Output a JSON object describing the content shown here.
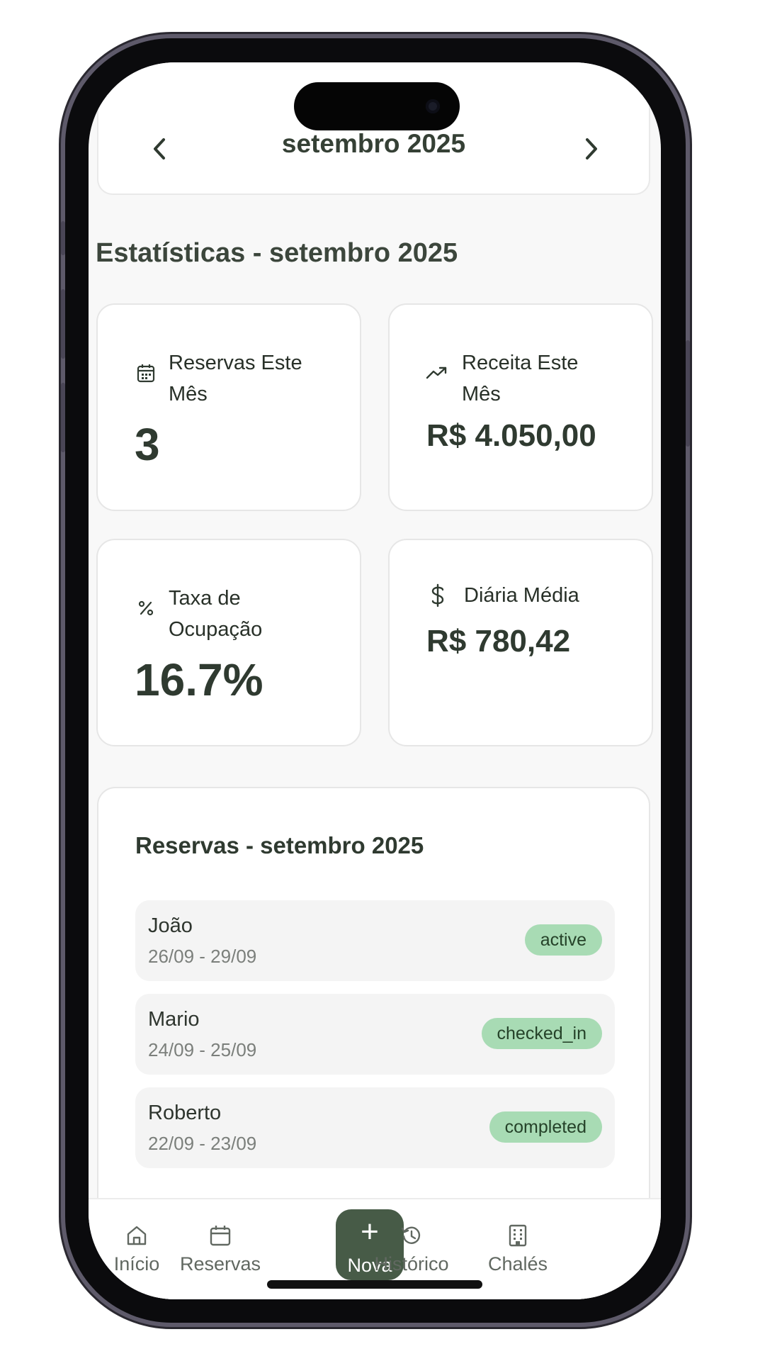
{
  "header": {
    "month_label": "setembro 2025"
  },
  "stats": {
    "section_title": "Estatísticas - setembro 2025",
    "reservations": {
      "label": "Reservas Este Mês",
      "value": "3",
      "icon": "calendar-icon"
    },
    "revenue": {
      "label": "Receita Este Mês",
      "value": "R$ 4.050,00",
      "icon": "trending-up-icon"
    },
    "occupancy": {
      "label": "Taxa de Ocupação",
      "value": "16.7%",
      "icon": "percent-icon"
    },
    "avg_daily": {
      "label": "Diária Média",
      "value": "R$ 780,42",
      "icon": "dollar-icon"
    }
  },
  "reservations": {
    "title": "Reservas - setembro 2025",
    "items": [
      {
        "name": "João",
        "dates": "26/09 - 29/09",
        "status": "active"
      },
      {
        "name": "Mario",
        "dates": "24/09 - 25/09",
        "status": "checked_in"
      },
      {
        "name": "Roberto",
        "dates": "22/09 - 23/09",
        "status": "completed"
      }
    ]
  },
  "bottom_nav": {
    "home": "Início",
    "reservas": "Reservas",
    "nova": "Nova",
    "historico": "Histórico",
    "chales": "Chalés"
  },
  "colors": {
    "accent": "#475b47",
    "badge": "#a8dbb4",
    "text_dark": "#2f3a30"
  }
}
